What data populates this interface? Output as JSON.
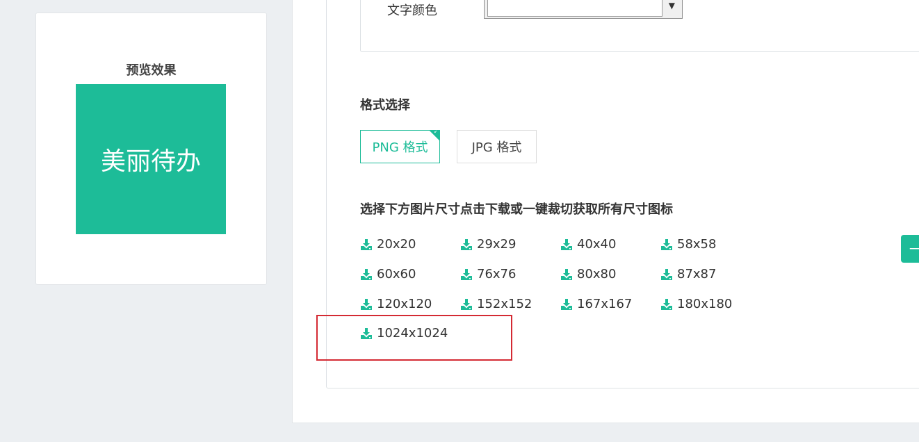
{
  "preview": {
    "title": "预览效果",
    "icon_text": "美丽待办",
    "icon_color": "#1dbc98"
  },
  "color_setting": {
    "label": "文字颜色",
    "value": "",
    "arrow": "▼"
  },
  "format": {
    "title": "格式选择",
    "options": [
      {
        "label": "PNG 格式",
        "selected": true
      },
      {
        "label": "JPG 格式",
        "selected": false
      }
    ],
    "check_mark": "✓"
  },
  "sizes": {
    "title": "选择下方图片尺寸点击下载或一键裁切获取所有尺寸图标",
    "icon": "download-icon",
    "items": [
      "20x20",
      "29x29",
      "40x40",
      "58x58",
      "60x60",
      "76x76",
      "80x80",
      "87x87",
      "120x120",
      "152x152",
      "167x167",
      "180x180",
      "1024x1024"
    ]
  },
  "cut_button": {
    "label": "一",
    "color": "#1dbc98"
  },
  "colors": {
    "accent": "#1dbc98",
    "highlight": "#d42a33"
  }
}
